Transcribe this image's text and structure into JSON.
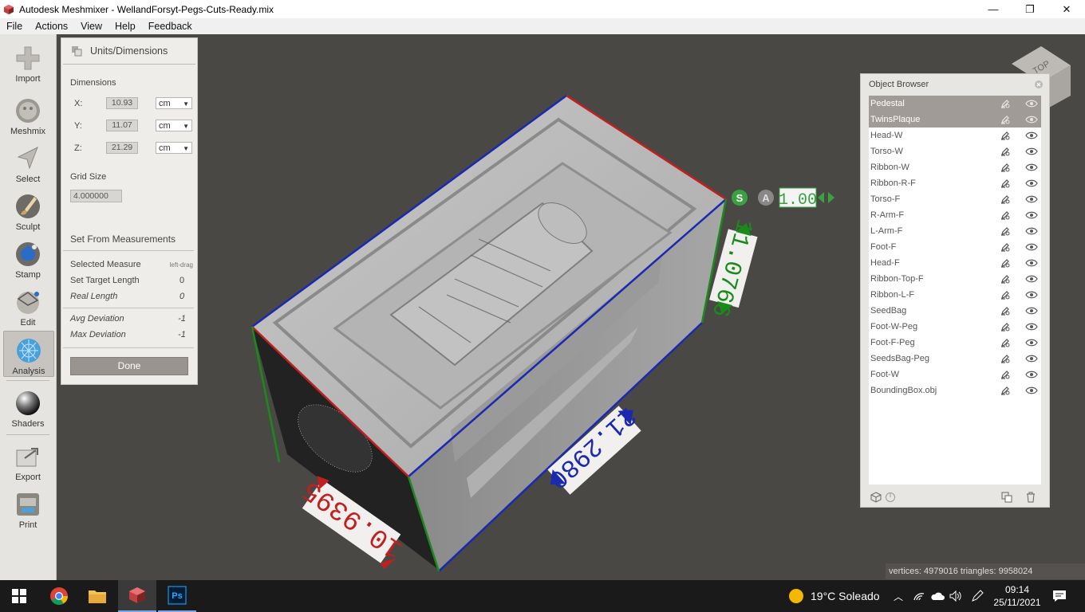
{
  "window": {
    "title": "Autodesk Meshmixer - WellandForsyt-Pegs-Cuts-Ready.mix",
    "minimize": "—",
    "maximize": "❐",
    "close": "✕"
  },
  "menu": [
    "File",
    "Actions",
    "View",
    "Help",
    "Feedback"
  ],
  "tools": [
    {
      "label": "Import",
      "icon": "plus-icon"
    },
    {
      "label": "Meshmix",
      "icon": "meshmix-icon"
    },
    {
      "label": "Select",
      "icon": "arrow-icon"
    },
    {
      "label": "Sculpt",
      "icon": "brush-icon"
    },
    {
      "label": "Stamp",
      "icon": "stamp-icon"
    },
    {
      "label": "Edit",
      "icon": "edit-icon"
    },
    {
      "label": "Analysis",
      "icon": "analysis-icon"
    },
    {
      "label": "Shaders",
      "icon": "sphere-icon"
    },
    {
      "label": "Export",
      "icon": "export-icon"
    },
    {
      "label": "Print",
      "icon": "printer-icon"
    }
  ],
  "panel": {
    "title": "Units/Dimensions",
    "dimensions_label": "Dimensions",
    "x": {
      "axis": "X:",
      "value": "10.93",
      "unit": "cm"
    },
    "y": {
      "axis": "Y:",
      "value": "11.07",
      "unit": "cm"
    },
    "z": {
      "axis": "Z:",
      "value": "21.29",
      "unit": "cm"
    },
    "grid_label": "Grid Size",
    "grid_value": "4.000000",
    "set_from": "Set From Measurements",
    "selected_measure": {
      "label": "Selected Measure",
      "value": "left-drag"
    },
    "target_length": {
      "label": "Set Target Length",
      "value": "0"
    },
    "real_length": {
      "label": "Real Length",
      "value": "0"
    },
    "avg_dev": {
      "label": "Avg Deviation",
      "value": "-1"
    },
    "max_dev": {
      "label": "Max Deviation",
      "value": "-1"
    },
    "done": "Done"
  },
  "viewport": {
    "scale_s": "S",
    "scale_a": "A",
    "scale_value": "1.00",
    "dim_red": "10.9395",
    "dim_blue": "21.2980",
    "dim_green": "11.0766",
    "viewcube": "TOP"
  },
  "browser": {
    "title": "Object Browser",
    "items": [
      {
        "name": "Pedestal",
        "selected": true
      },
      {
        "name": "TwinsPlaque",
        "selected": true
      },
      {
        "name": "Head-W"
      },
      {
        "name": "Torso-W"
      },
      {
        "name": "Ribbon-W"
      },
      {
        "name": "Ribbon-R-F"
      },
      {
        "name": "Torso-F"
      },
      {
        "name": "R-Arm-F"
      },
      {
        "name": "L-Arm-F"
      },
      {
        "name": "Foot-F"
      },
      {
        "name": "Head-F"
      },
      {
        "name": "Ribbon-Top-F"
      },
      {
        "name": "Ribbon-L-F"
      },
      {
        "name": "SeedBag"
      },
      {
        "name": "Foot-W-Peg"
      },
      {
        "name": "Foot-F-Peg"
      },
      {
        "name": "SeedsBag-Peg"
      },
      {
        "name": "Foot-W"
      },
      {
        "name": "BoundingBox.obj"
      }
    ]
  },
  "status": "vertices: 4979016 triangles: 9958024",
  "taskbar": {
    "weather": "19°C  Soleado",
    "time": "09:14",
    "date": "25/11/2021"
  }
}
